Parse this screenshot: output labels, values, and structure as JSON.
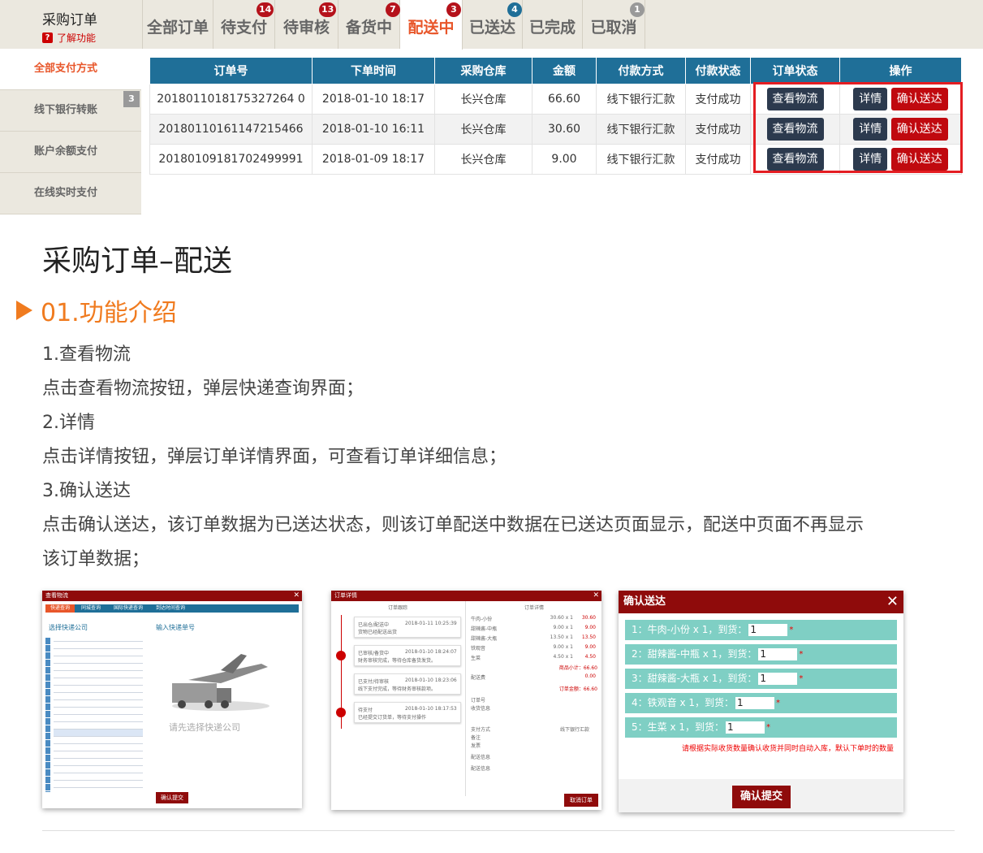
{
  "header": {
    "app_title": "采购订单",
    "help_icon": "?",
    "help_label": "了解功能",
    "tabs": [
      {
        "label": "全部订单",
        "badge": ""
      },
      {
        "label": "待支付",
        "badge": "14"
      },
      {
        "label": "待审核",
        "badge": "13"
      },
      {
        "label": "备货中",
        "badge": "7"
      },
      {
        "label": "配送中",
        "badge": "3",
        "active": true
      },
      {
        "label": "已送达",
        "badge": "4"
      },
      {
        "label": "已完成",
        "badge": ""
      },
      {
        "label": "已取消",
        "badge": "1"
      }
    ],
    "colors": {
      "badge_red": "#b5121b",
      "badge_blue": "#1f6f98",
      "badge_gray": "#999999",
      "active_tab": "#e8562a"
    }
  },
  "sidebar": {
    "items": [
      {
        "label": "全部支付方式",
        "active": true
      },
      {
        "label": "线下银行转账",
        "badge": "3"
      },
      {
        "label": "账户余额支付"
      },
      {
        "label": "在线实时支付"
      }
    ]
  },
  "table": {
    "headers": [
      "订单号",
      "下单时间",
      "采购仓库",
      "金额",
      "付款方式",
      "付款状态",
      "订单状态",
      "操作"
    ],
    "rows": [
      {
        "order_no": "2018011018175327264 0",
        "time": "2018-01-10 18:17",
        "warehouse": "长兴仓库",
        "amount": "66.60",
        "pay_method": "线下银行汇款",
        "pay_status": "支付成功"
      },
      {
        "order_no": "20180110161147215466",
        "time": "2018-01-10 16:11",
        "warehouse": "长兴仓库",
        "amount": "30.60",
        "pay_method": "线下银行汇款",
        "pay_status": "支付成功"
      },
      {
        "order_no": "20180109181702499991",
        "time": "2018-01-09 18:17",
        "warehouse": "长兴仓库",
        "amount": "9.00",
        "pay_method": "线下银行汇款",
        "pay_status": "支付成功"
      }
    ],
    "btn_logistics": "查看物流",
    "btn_detail": "详情",
    "btn_confirm": "确认送达"
  },
  "doc": {
    "title": "采购订单–配送",
    "section": "01.功能介绍",
    "lines": [
      "1.查看物流",
      "点击查看物流按钮，弹层快递查询界面；",
      "2.详情",
      "点击详情按钮，弹层订单详情界面，可查看订单详细信息；",
      "3.确认送达",
      "点击确认送达，该订单数据为已送达状态，则该订单配送中数据在已送达页面显示，配送中页面不再显示",
      "该订单数据；"
    ]
  },
  "thumb_logistics": {
    "title": "查看物流",
    "tabs": [
      "快递查询",
      "同城查询",
      "国际快递查询",
      "到达时间查询"
    ],
    "step1": "选择快递公司",
    "step2": "输入快递单号",
    "placeholder": "请先选择快递公司",
    "submit": "确认提交"
  },
  "thumb_detail": {
    "title": "订单详情",
    "col_left": "订单跟踪",
    "col_right": "订单详情",
    "events": [
      {
        "status": "已出仓/配送中",
        "time": "2018-01-11 10:25:39",
        "note": "货物已经配送出货"
      },
      {
        "status": "已审核/备货中",
        "time": "2018-01-10 18:24:07",
        "note": "财务审核完成，等待仓库备货发货。"
      },
      {
        "status": "已支付/待审核",
        "time": "2018-01-10 18:23:06",
        "note": "线下支付完成，等待财务审核款项。"
      },
      {
        "status": "待支付",
        "time": "2018-01-10 18:17:53",
        "note": "已经提交订货单，等待支付操作"
      }
    ],
    "items": [
      {
        "name": "牛肉-小份",
        "qty": "30.60 x 1",
        "price": "30.60"
      },
      {
        "name": "甜辣酱-中瓶",
        "qty": "9.00 x 1",
        "price": "9.00"
      },
      {
        "name": "甜辣酱-大瓶",
        "qty": "13.50 x 1",
        "price": "13.50"
      },
      {
        "name": "铁观音",
        "qty": "9.00 x 1",
        "price": "9.00"
      },
      {
        "name": "生菜",
        "qty": "4.50 x 1",
        "price": "4.50"
      }
    ],
    "subtotal": "商品小计：66.60",
    "delivery_label": "配送费",
    "delivery_fee": "0.00",
    "total": "订单金额：66.60",
    "fields": [
      "订单号",
      "收货信息",
      "支付方式",
      "备注",
      "发票",
      "配送信息",
      "配送信息"
    ],
    "pay_method": "线下银行汇款",
    "cancel": "取消订单"
  },
  "thumb_confirm": {
    "title": "确认送达",
    "rows": [
      {
        "label": "1：牛肉-小份 x 1，到货：",
        "value": "1"
      },
      {
        "label": "2：甜辣酱-中瓶 x 1，到货：",
        "value": "1"
      },
      {
        "label": "3：甜辣酱-大瓶 x 1，到货：",
        "value": "1"
      },
      {
        "label": "4：铁观音 x 1，到货：",
        "value": "1"
      },
      {
        "label": "5：生菜 x 1，到货：",
        "value": "1"
      }
    ],
    "note": "请根据实际收货数量确认收货并同时自动入库，默认下单时的数量",
    "submit": "确认提交"
  }
}
